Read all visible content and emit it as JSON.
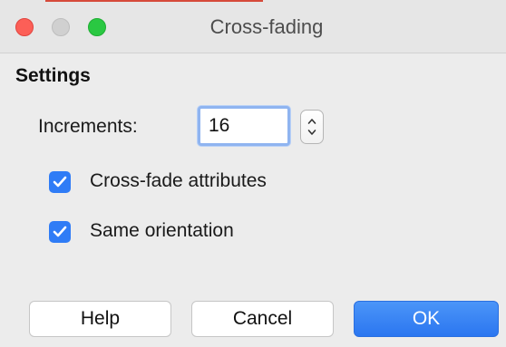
{
  "window": {
    "title": "Cross-fading"
  },
  "settings": {
    "heading": "Settings",
    "increments_label": "Increments:",
    "increments_value": "16",
    "cross_fade_attributes": {
      "label": "Cross-fade attributes",
      "checked": true
    },
    "same_orientation": {
      "label": "Same orientation",
      "checked": true
    }
  },
  "buttons": {
    "help": "Help",
    "cancel": "Cancel",
    "ok": "OK"
  },
  "colors": {
    "accent": "#2f7cf6",
    "close": "#fc5f57",
    "zoom": "#2ac842"
  },
  "icons": {
    "close": "close-icon",
    "minimize": "minimize-icon",
    "zoom": "zoom-icon",
    "checkmark": "checkmark-icon",
    "stepper_up": "chevron-up-icon",
    "stepper_down": "chevron-down-icon"
  }
}
